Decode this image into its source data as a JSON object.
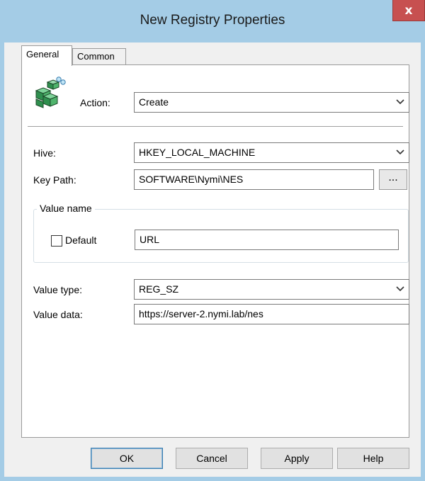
{
  "window": {
    "title": "New Registry Properties",
    "close_glyph": "x"
  },
  "tabs": [
    {
      "label": "General",
      "active": true
    },
    {
      "label": "Common",
      "active": false
    }
  ],
  "general": {
    "icon": "registry-icon",
    "action": {
      "label": "Action:",
      "value": "Create"
    },
    "hive": {
      "label": "Hive:",
      "value": "HKEY_LOCAL_MACHINE"
    },
    "key_path": {
      "label": "Key Path:",
      "value": "SOFTWARE\\Nymi\\NES",
      "browse_label": "..."
    },
    "value_name": {
      "group_label": "Value name",
      "default_label": "Default",
      "default_checked": false,
      "value": "URL"
    },
    "value_type": {
      "label": "Value type:",
      "value": "REG_SZ"
    },
    "value_data": {
      "label": "Value data:",
      "value": "https://server-2.nymi.lab/nes"
    }
  },
  "buttons": {
    "ok": "OK",
    "cancel": "Cancel",
    "apply": "Apply",
    "help": "Help"
  },
  "colors": {
    "titlebar": "#a4cce6",
    "close_button": "#c75050",
    "panel": "#ffffff",
    "window": "#f0f0f0"
  }
}
